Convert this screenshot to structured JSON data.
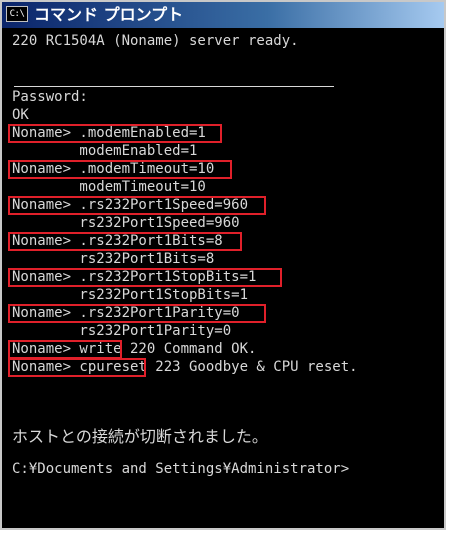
{
  "window": {
    "title": "コマンド プロンプト",
    "icon_text": "C:\\",
    "icon_name": "cmd-icon"
  },
  "console": {
    "lines": [
      "220 RC1504A (Noname) server ready.",
      "Password:",
      "OK",
      "Noname> .modemEnabled=1",
      "        modemEnabled=1",
      "Noname> .modemTimeout=10",
      "        modemTimeout=10",
      "Noname> .rs232Port1Speed=960",
      "        rs232Port1Speed=960",
      "Noname> .rs232Port1Bits=8",
      "        rs232Port1Bits=8",
      "Noname> .rs232Port1StopBits=1",
      "        rs232Port1StopBits=1",
      "Noname> .rs232Port1Parity=0",
      "        rs232Port1Parity=0",
      "Noname> write 220 Command OK.",
      "Noname> cpureset 223 Goodbye & CPU reset.",
      "ホストとの接続が切断されました。",
      "C:¥Documents and Settings¥Administrator>"
    ]
  },
  "colors": {
    "console_bg": "#000000",
    "console_text": "#d8d8d8",
    "highlight": "#e0202a",
    "titlebar_start": "#0a246a",
    "titlebar_end": "#a6caf0"
  }
}
